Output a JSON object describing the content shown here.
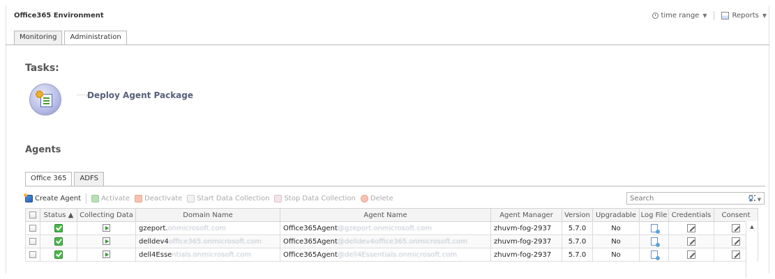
{
  "header": {
    "title": "Office365 Environment",
    "time_range_label": "time range",
    "reports_label": "Reports"
  },
  "top_tabs": [
    {
      "label": "Monitoring",
      "active": false
    },
    {
      "label": "Administration",
      "active": true
    }
  ],
  "tasks": {
    "heading": "Tasks:",
    "items": [
      {
        "label": "Deploy Agent Package"
      }
    ]
  },
  "agents": {
    "heading": "Agents",
    "tabs": [
      {
        "label": "Office 365",
        "active": true
      },
      {
        "label": "ADFS",
        "active": false
      }
    ],
    "toolbar": {
      "create": "Create Agent",
      "activate": "Activate",
      "deactivate": "Deactivate",
      "start": "Start Data Collection",
      "stop": "Stop Data Collection",
      "delete": "Delete",
      "search_placeholder": "Search"
    },
    "columns": [
      "Status ▲",
      "Collecting Data",
      "Domain Name",
      "Agent Name",
      "Agent Manager",
      "Version",
      "Upgradable",
      "Log File",
      "Credentials",
      "Consent"
    ],
    "rows": [
      {
        "domain": "gzeport.",
        "domain_hidden": "onmicrosoft.com",
        "agent": "Office365Agent",
        "agent_hidden": "@gzeport.onmicrosoft.com",
        "manager": "zhuvm-fog-2937",
        "version": "5.7.0",
        "upgradable": "No"
      },
      {
        "domain": "delldev4",
        "domain_hidden": "office365.onmicrosoft.com",
        "agent": "Office365Agent",
        "agent_hidden": "@delldev4office365.onmicrosoft.com",
        "manager": "zhuvm-fog-2937",
        "version": "5.7.0",
        "upgradable": "No"
      },
      {
        "domain": "dell4Esse",
        "domain_hidden": "ntials.onmicrosoft.com",
        "agent": "Office365Agent",
        "agent_hidden": "@dell4Essentials.onmicrosoft.com",
        "manager": "zhuvm-fog-2937",
        "version": "5.7.0",
        "upgradable": "No"
      }
    ]
  },
  "colors": {
    "status_green": "#4ab84a",
    "task_link": "#57607a",
    "border": "#b8b8b8"
  }
}
